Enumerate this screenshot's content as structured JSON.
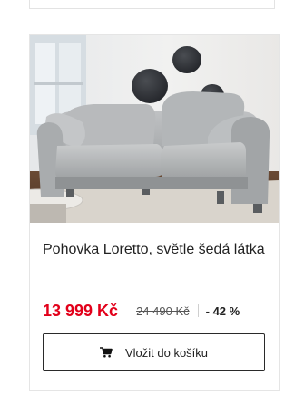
{
  "product": {
    "image_alt": "Pohovka Loretto",
    "title": "Pohovka Loretto, světle šedá látka",
    "price_current": "13 999 Kč",
    "price_old": "24 490 Kč",
    "discount": "- 42 %",
    "cart_button_label": "Vložit do košíku",
    "cart_icon": "shopping-cart-icon"
  },
  "colors": {
    "price": "#e2001a",
    "text": "#222222",
    "border": "#e5e5e5"
  }
}
